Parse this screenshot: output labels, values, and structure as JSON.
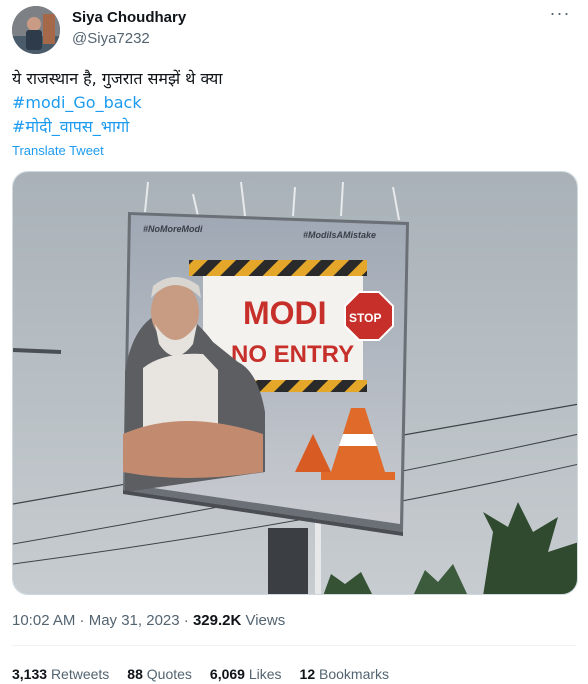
{
  "author": {
    "name": "Siya Choudhary",
    "handle": "@Siya7232"
  },
  "tweet": {
    "line1": "ये राजस्थान है, गुजरात समझें थे क्या",
    "hashtag1": "#modi_Go_back",
    "hashtag2": "#मोदी_वापस_भागो",
    "translate": "Translate Tweet"
  },
  "billboard": {
    "tag_left": "#NoMoreModi",
    "tag_right": "#ModiIsAMistake",
    "headline1": "MODI",
    "headline2": "NO ENTRY",
    "stop_sign": "STOP"
  },
  "meta": {
    "time_date": "10:02 AM · May 31, 2023 · ",
    "views_count": "329.2K",
    "views_label": " Views"
  },
  "stats": {
    "retweets_count": "3,133",
    "retweets_label": "Retweets",
    "quotes_count": "88",
    "quotes_label": "Quotes",
    "likes_count": "6,069",
    "likes_label": "Likes",
    "bookmarks_count": "12",
    "bookmarks_label": "Bookmarks"
  },
  "colors": {
    "link": "#1d9bf0",
    "text": "#0f1419",
    "secondary": "#536471"
  },
  "icons": {
    "more": "more-horizontal-icon"
  }
}
